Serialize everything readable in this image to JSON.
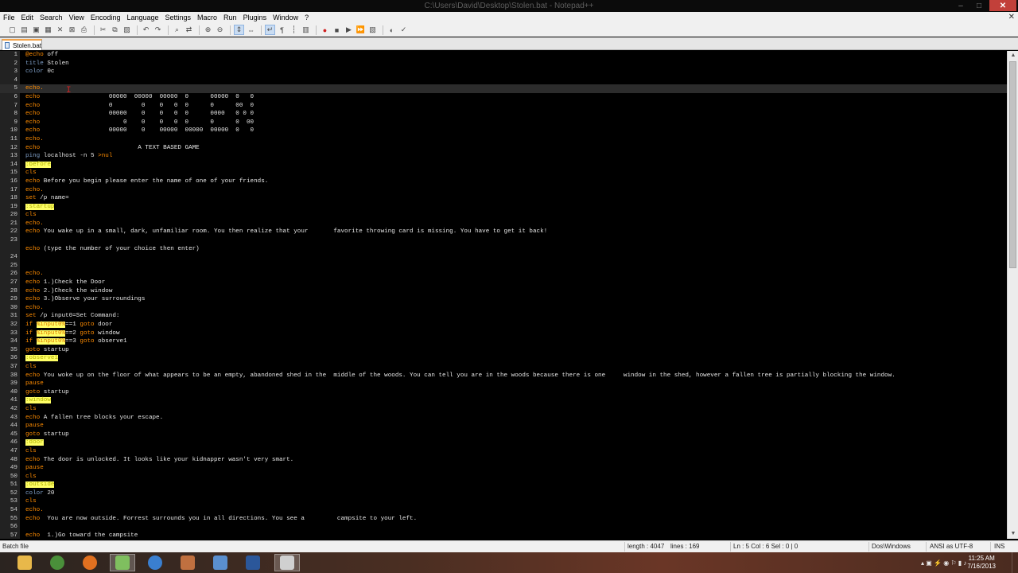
{
  "window": {
    "title": "C:\\Users\\David\\Desktop\\Stolen.bat - Notepad++",
    "minimize_glyph": "–",
    "maximize_glyph": "□",
    "close_glyph": "✕"
  },
  "menu": {
    "items": [
      "File",
      "Edit",
      "Search",
      "View",
      "Encoding",
      "Language",
      "Settings",
      "Macro",
      "Run",
      "Plugins",
      "Window",
      "?"
    ],
    "close_glyph": "✕"
  },
  "toolbar": {
    "icons": [
      "new-file-icon",
      "open-file-icon",
      "save-icon",
      "save-all-icon",
      "close-icon",
      "close-all-icon",
      "print-icon",
      "cut-icon",
      "copy-icon",
      "paste-icon",
      "undo-icon",
      "redo-icon",
      "find-icon",
      "replace-icon",
      "zoom-in-icon",
      "zoom-out-icon",
      "sync-vertical-icon",
      "sync-horizontal-icon",
      "word-wrap-icon",
      "show-all-chars-icon",
      "indent-guide-icon",
      "doc-map-icon",
      "record-macro-icon",
      "stop-record-icon",
      "play-macro-icon",
      "play-multiple-icon",
      "save-macro-icon",
      "launch-browser-icon",
      "spell-check-icon"
    ]
  },
  "tabs": [
    {
      "label": "Stolen.bat",
      "active": true
    }
  ],
  "editor": {
    "current_line": 5,
    "lines": [
      {
        "n": "1",
        "parts": [
          [
            "kw",
            "@echo"
          ],
          [
            "",
            " off"
          ]
        ]
      },
      {
        "n": "2",
        "parts": [
          [
            "kw2",
            "title"
          ],
          [
            "",
            " Stolen"
          ]
        ]
      },
      {
        "n": "3",
        "parts": [
          [
            "kw2",
            "color"
          ],
          [
            "",
            " 0c"
          ]
        ]
      },
      {
        "n": "4",
        "parts": []
      },
      {
        "n": "5",
        "parts": [
          [
            "kw",
            "echo."
          ]
        ]
      },
      {
        "n": "6",
        "parts": [
          [
            "kw",
            "echo"
          ],
          [
            "",
            "                   00000  00000  00000  0      00000  0   0"
          ]
        ]
      },
      {
        "n": "7",
        "parts": [
          [
            "kw",
            "echo"
          ],
          [
            "",
            "                   0        0    0   0  0      0      00  0"
          ]
        ]
      },
      {
        "n": "8",
        "parts": [
          [
            "kw",
            "echo"
          ],
          [
            "",
            "                   00000    0    0   0  0      0000   0 0 0"
          ]
        ]
      },
      {
        "n": "9",
        "parts": [
          [
            "kw",
            "echo"
          ],
          [
            "",
            "                       0    0    0   0  0      0      0  00"
          ]
        ]
      },
      {
        "n": "10",
        "parts": [
          [
            "kw",
            "echo"
          ],
          [
            "",
            "                   00000    0    00000  00000  00000  0   0"
          ]
        ]
      },
      {
        "n": "11",
        "parts": [
          [
            "kw",
            "echo."
          ]
        ]
      },
      {
        "n": "12",
        "parts": [
          [
            "kw",
            "echo"
          ],
          [
            "",
            "                           A TEXT BASED GAME"
          ]
        ]
      },
      {
        "n": "13",
        "parts": [
          [
            "kw2",
            "ping"
          ],
          [
            "",
            " localhost -n 5 "
          ],
          [
            "kw",
            ">nul"
          ]
        ]
      },
      {
        "n": "14",
        "parts": [
          [
            "lbl",
            ":before"
          ]
        ]
      },
      {
        "n": "15",
        "parts": [
          [
            "kw",
            "cls"
          ]
        ]
      },
      {
        "n": "16",
        "parts": [
          [
            "kw",
            "echo"
          ],
          [
            "",
            " Before you begin please enter the name of one of your friends."
          ]
        ]
      },
      {
        "n": "17",
        "parts": [
          [
            "kw",
            "echo."
          ]
        ]
      },
      {
        "n": "18",
        "parts": [
          [
            "kw",
            "set"
          ],
          [
            "",
            " /p name="
          ]
        ]
      },
      {
        "n": "19",
        "parts": [
          [
            "lbl",
            ":startup"
          ]
        ]
      },
      {
        "n": "20",
        "parts": [
          [
            "kw",
            "cls"
          ]
        ]
      },
      {
        "n": "21",
        "parts": [
          [
            "kw",
            "echo."
          ]
        ]
      },
      {
        "n": "22",
        "parts": [
          [
            "kw",
            "echo"
          ],
          [
            "",
            " You wake up in a small, dark, unfamiliar room. You then realize that your       favorite throwing card is missing. You have to get it back!"
          ]
        ]
      },
      {
        "n": "23",
        "parts": []
      },
      {
        "n": "",
        "parts": [
          [
            "kw",
            "echo"
          ],
          [
            "",
            " (type the number of your choice then enter)"
          ]
        ]
      },
      {
        "n": "24",
        "parts": []
      },
      {
        "n": "25",
        "parts": []
      },
      {
        "n": "26",
        "parts": [
          [
            "kw",
            "echo."
          ]
        ]
      },
      {
        "n": "27",
        "parts": [
          [
            "kw",
            "echo"
          ],
          [
            "",
            " 1.)Check the Door"
          ]
        ]
      },
      {
        "n": "28",
        "parts": [
          [
            "kw",
            "echo"
          ],
          [
            "",
            " 2.)Check the window"
          ]
        ]
      },
      {
        "n": "29",
        "parts": [
          [
            "kw",
            "echo"
          ],
          [
            "",
            " 3.)Observe your surroundings"
          ]
        ]
      },
      {
        "n": "30",
        "parts": [
          [
            "kw",
            "echo."
          ]
        ]
      },
      {
        "n": "31",
        "parts": [
          [
            "kw",
            "set"
          ],
          [
            "",
            " /p input0=Set Command:"
          ]
        ]
      },
      {
        "n": "32",
        "parts": [
          [
            "kw",
            "if"
          ],
          [
            "",
            " "
          ],
          [
            "var",
            "%input0%"
          ],
          [
            "",
            "==1 "
          ],
          [
            "kw",
            "goto"
          ],
          [
            "",
            " door"
          ]
        ]
      },
      {
        "n": "33",
        "parts": [
          [
            "kw",
            "if"
          ],
          [
            "",
            " "
          ],
          [
            "var",
            "%input0%"
          ],
          [
            "",
            "==2 "
          ],
          [
            "kw",
            "goto"
          ],
          [
            "",
            " window"
          ]
        ]
      },
      {
        "n": "34",
        "parts": [
          [
            "kw",
            "if"
          ],
          [
            "",
            " "
          ],
          [
            "var",
            "%input0%"
          ],
          [
            "",
            "==3 "
          ],
          [
            "kw",
            "goto"
          ],
          [
            "",
            " observe1"
          ]
        ]
      },
      {
        "n": "35",
        "parts": [
          [
            "kw",
            "goto"
          ],
          [
            "",
            " startup"
          ]
        ]
      },
      {
        "n": "36",
        "parts": [
          [
            "lbl",
            ":observe1"
          ]
        ]
      },
      {
        "n": "37",
        "parts": [
          [
            "kw",
            "cls"
          ]
        ]
      },
      {
        "n": "38",
        "parts": [
          [
            "kw",
            "echo"
          ],
          [
            "",
            " You woke up on the floor of what appears to be an empty, abandoned shed in the  middle of the woods. You can tell you are in the woods because there is one     window in the shed, however a fallen tree is partially blocking the window."
          ]
        ]
      },
      {
        "n": "39",
        "parts": [
          [
            "kw",
            "pause"
          ]
        ]
      },
      {
        "n": "40",
        "parts": [
          [
            "kw",
            "goto"
          ],
          [
            "",
            " startup"
          ]
        ]
      },
      {
        "n": "41",
        "parts": [
          [
            "lbl",
            ":window"
          ]
        ]
      },
      {
        "n": "42",
        "parts": [
          [
            "kw",
            "cls"
          ]
        ]
      },
      {
        "n": "43",
        "parts": [
          [
            "kw",
            "echo"
          ],
          [
            "",
            " A fallen tree blocks your escape."
          ]
        ]
      },
      {
        "n": "44",
        "parts": [
          [
            "kw",
            "pause"
          ]
        ]
      },
      {
        "n": "45",
        "parts": [
          [
            "kw",
            "goto"
          ],
          [
            "",
            " startup"
          ]
        ]
      },
      {
        "n": "46",
        "parts": [
          [
            "lbl",
            ":door"
          ]
        ]
      },
      {
        "n": "47",
        "parts": [
          [
            "kw",
            "cls"
          ]
        ]
      },
      {
        "n": "48",
        "parts": [
          [
            "kw",
            "echo"
          ],
          [
            "",
            " The door is unlocked. It looks like your kidnapper wasn't very smart."
          ]
        ]
      },
      {
        "n": "49",
        "parts": [
          [
            "kw",
            "pause"
          ]
        ]
      },
      {
        "n": "50",
        "parts": [
          [
            "kw",
            "cls"
          ]
        ]
      },
      {
        "n": "51",
        "parts": [
          [
            "lbl",
            ":outside"
          ]
        ]
      },
      {
        "n": "52",
        "parts": [
          [
            "kw2",
            "color"
          ],
          [
            "",
            " 20"
          ]
        ]
      },
      {
        "n": "53",
        "parts": [
          [
            "kw",
            "cls"
          ]
        ]
      },
      {
        "n": "54",
        "parts": [
          [
            "kw",
            "echo."
          ]
        ]
      },
      {
        "n": "55",
        "parts": [
          [
            "kw",
            "echo"
          ],
          [
            "",
            "  You are now outside. Forrest surrounds you in all directions. You see a         campsite to your left."
          ]
        ]
      },
      {
        "n": "56",
        "parts": []
      },
      {
        "n": "57",
        "parts": [
          [
            "kw",
            "echo"
          ],
          [
            "",
            "  1.)Go toward the campsite"
          ]
        ]
      }
    ]
  },
  "status": {
    "file_type": "Batch file",
    "length": "length : 4047",
    "lines": "lines : 169",
    "position": "Ln : 5    Col : 6    Sel : 0 | 0",
    "eol": "Dos\\Windows",
    "encoding": "ANSI as UTF-8",
    "mode": "INS"
  },
  "taskbar": {
    "apps": [
      {
        "name": "file-explorer-icon",
        "color": "#e8b84a",
        "active": false
      },
      {
        "name": "chrome-icon",
        "color": "#4a8f3a",
        "active": false
      },
      {
        "name": "firefox-icon",
        "color": "#e07020",
        "active": false
      },
      {
        "name": "notepadpp-icon",
        "color": "#7fbf5f",
        "active": true
      },
      {
        "name": "itunes-icon",
        "color": "#3a7fd0",
        "active": false
      },
      {
        "name": "paint-icon",
        "color": "#c07040",
        "active": false
      },
      {
        "name": "thunderbird-icon",
        "color": "#5a8fcf",
        "active": false
      },
      {
        "name": "word-icon",
        "color": "#2b579a",
        "active": false
      },
      {
        "name": "console-icon",
        "color": "#d0d0d0",
        "active": true
      }
    ],
    "time": "11:25 AM",
    "date": "7/16/2013",
    "tray_glyphs": "▴  ▣  ⚡  ◉  ⚐  ▮  ♪"
  }
}
